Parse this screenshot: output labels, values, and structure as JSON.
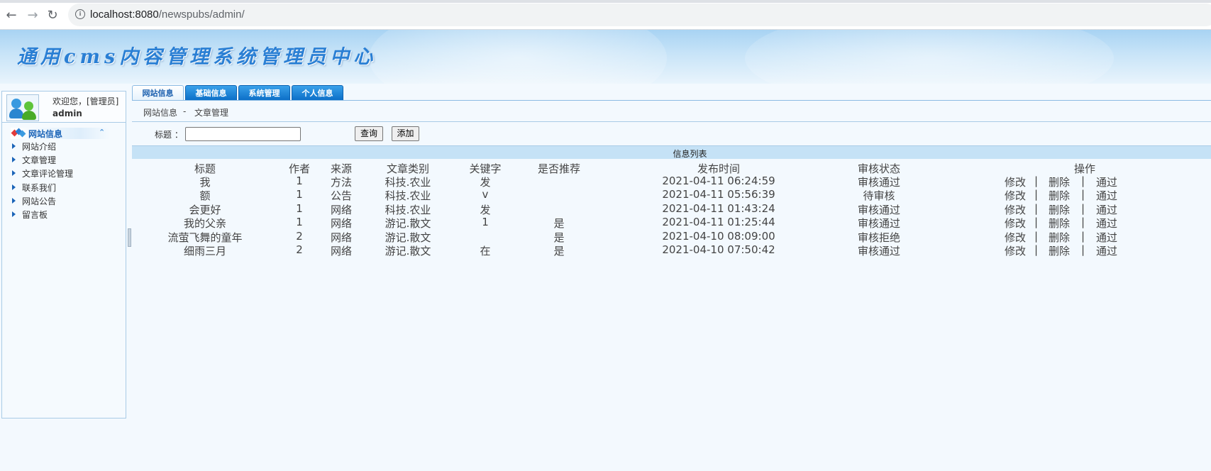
{
  "browser": {
    "url_host": "localhost:8080",
    "url_path": "/newspubs/admin/"
  },
  "banner": {
    "title": "通用cms内容管理系统管理员中心"
  },
  "user": {
    "welcome": "欢迎您，[管理员]",
    "name": "admin"
  },
  "sidebar": {
    "section": "网站信息",
    "items": [
      {
        "label": "网站介绍"
      },
      {
        "label": "文章管理"
      },
      {
        "label": "文章评论管理"
      },
      {
        "label": "联系我们"
      },
      {
        "label": "网站公告"
      },
      {
        "label": "留言板"
      }
    ]
  },
  "tabs": [
    {
      "label": "网站信息",
      "active": true
    },
    {
      "label": "基础信息",
      "active": false
    },
    {
      "label": "系统管理",
      "active": false
    },
    {
      "label": "个人信息",
      "active": false
    }
  ],
  "breadcrumb": {
    "parent": "网站信息",
    "sep": "-",
    "current": "文章管理"
  },
  "search": {
    "label": "标题 ：",
    "value": "",
    "query_label": "查询",
    "add_label": "添加"
  },
  "table": {
    "title": "信息列表",
    "columns": [
      "标题",
      "作者",
      "来源",
      "文章类别",
      "关键字",
      "是否推荐",
      "发布时间",
      "审核状态",
      "操作"
    ],
    "rows": [
      {
        "title": "我",
        "author": "1",
        "source": "方法",
        "category": "科技.农业",
        "keyword": "发",
        "recommend": "",
        "time": "2021-04-11 06:24:59",
        "status": "审核通过"
      },
      {
        "title": "额",
        "author": "1",
        "source": "公告",
        "category": "科技.农业",
        "keyword": "v",
        "recommend": "",
        "time": "2021-04-11 05:56:39",
        "status": "待审核"
      },
      {
        "title": "会更好",
        "author": "1",
        "source": "网络",
        "category": "科技.农业",
        "keyword": "发",
        "recommend": "",
        "time": "2021-04-11 01:43:24",
        "status": "审核通过"
      },
      {
        "title": "我的父亲",
        "author": "1",
        "source": "网络",
        "category": "游记.散文",
        "keyword": "1",
        "recommend": "是",
        "time": "2021-04-11 01:25:44",
        "status": "审核通过"
      },
      {
        "title": "流萤飞舞的童年",
        "author": "2",
        "source": "网络",
        "category": "游记.散文",
        "keyword": "",
        "recommend": "是",
        "time": "2021-04-10 08:09:00",
        "status": "审核拒绝"
      },
      {
        "title": "细雨三月",
        "author": "2",
        "source": "网络",
        "category": "游记.散文",
        "keyword": "在",
        "recommend": "是",
        "time": "2021-04-10 07:50:42",
        "status": "审核通过"
      }
    ],
    "ops": {
      "edit": "修改",
      "sep": "|",
      "delete": "删除",
      "approve": "通过"
    }
  },
  "colors": {
    "tab_blue": "#0c6fc8",
    "list_header": "#c5e2f6",
    "banner_title": "#2a7fd4"
  }
}
